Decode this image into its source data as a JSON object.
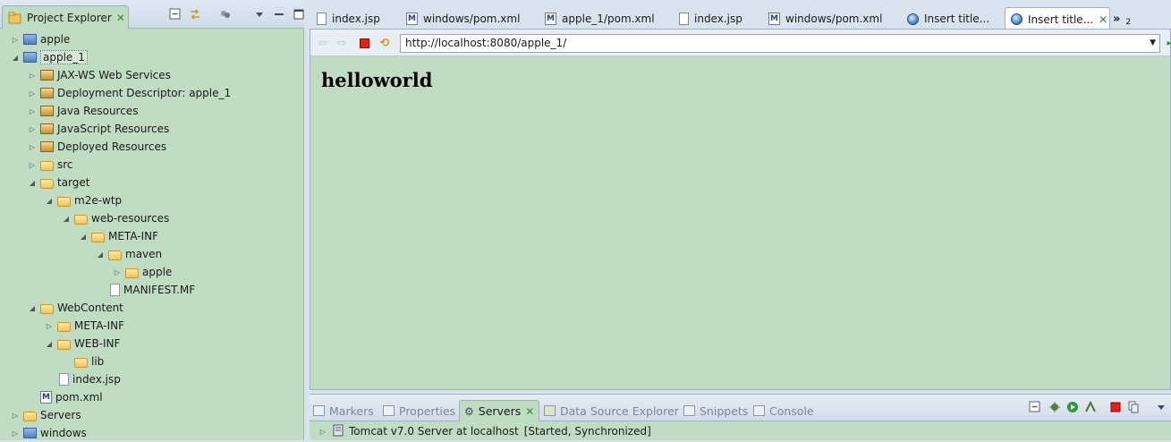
{
  "explorer": {
    "title": "Project Explorer",
    "tree": [
      {
        "label": "apple",
        "depth": 0,
        "twisty": "closed",
        "icon": "project-icon"
      },
      {
        "label": "apple_1",
        "depth": 0,
        "twisty": "open",
        "icon": "project-icon",
        "selected": true
      },
      {
        "label": "JAX-WS Web Services",
        "depth": 1,
        "twisty": "closed",
        "icon": "webservices-icon"
      },
      {
        "label": "Deployment Descriptor: apple_1",
        "depth": 1,
        "twisty": "closed",
        "icon": "descriptor-icon"
      },
      {
        "label": "Java Resources",
        "depth": 1,
        "twisty": "closed",
        "icon": "java-resources-icon"
      },
      {
        "label": "JavaScript Resources",
        "depth": 1,
        "twisty": "closed",
        "icon": "javascript-resources-icon"
      },
      {
        "label": "Deployed Resources",
        "depth": 1,
        "twisty": "closed",
        "icon": "deployed-resources-icon"
      },
      {
        "label": "src",
        "depth": 1,
        "twisty": "closed",
        "icon": "folder-icon"
      },
      {
        "label": "target",
        "depth": 1,
        "twisty": "open",
        "icon": "folder-icon"
      },
      {
        "label": "m2e-wtp",
        "depth": 2,
        "twisty": "open",
        "icon": "folder-icon"
      },
      {
        "label": "web-resources",
        "depth": 3,
        "twisty": "open",
        "icon": "folder-icon"
      },
      {
        "label": "META-INF",
        "depth": 4,
        "twisty": "open",
        "icon": "folder-icon"
      },
      {
        "label": "maven",
        "depth": 5,
        "twisty": "open",
        "icon": "folder-icon"
      },
      {
        "label": "apple",
        "depth": 6,
        "twisty": "closed",
        "icon": "folder-icon"
      },
      {
        "label": "MANIFEST.MF",
        "depth": 5,
        "twisty": "none",
        "icon": "file-icon"
      },
      {
        "label": "WebContent",
        "depth": 1,
        "twisty": "open",
        "icon": "folder-icon"
      },
      {
        "label": "META-INF",
        "depth": 2,
        "twisty": "closed",
        "icon": "folder-icon"
      },
      {
        "label": "WEB-INF",
        "depth": 2,
        "twisty": "open",
        "icon": "folder-icon"
      },
      {
        "label": "lib",
        "depth": 3,
        "twisty": "none",
        "icon": "folder-icon"
      },
      {
        "label": "index.jsp",
        "depth": 2,
        "twisty": "none",
        "icon": "file-icon"
      },
      {
        "label": "pom.xml",
        "depth": 1,
        "twisty": "none",
        "icon": "maven-file-icon"
      },
      {
        "label": "Servers",
        "depth": 0,
        "twisty": "closed",
        "icon": "folder-icon"
      },
      {
        "label": "windows",
        "depth": 0,
        "twisty": "closed",
        "icon": "project-icon"
      }
    ]
  },
  "editor": {
    "tabs": [
      {
        "label": "index.jsp",
        "icon": "jsp-file-icon"
      },
      {
        "label": "windows/pom.xml",
        "icon": "maven-file-icon"
      },
      {
        "label": "apple_1/pom.xml",
        "icon": "maven-file-icon"
      },
      {
        "label": "index.jsp",
        "icon": "jsp-file-icon"
      },
      {
        "label": "windows/pom.xml",
        "icon": "maven-file-icon"
      },
      {
        "label": "Insert title...",
        "icon": "globe-icon"
      },
      {
        "label": "Insert title...",
        "icon": "globe-icon",
        "active": true
      }
    ],
    "overflow_label": "»",
    "overflow_count": "2"
  },
  "browser": {
    "url": "http://localhost:8080/apple_1/",
    "heading": "helloworld"
  },
  "bottom_panel": {
    "tabs": [
      {
        "label": "Markers",
        "icon": "markers-icon"
      },
      {
        "label": "Properties",
        "icon": "properties-icon"
      },
      {
        "label": "Servers",
        "icon": "servers-icon",
        "active": true
      },
      {
        "label": "Data Source Explorer",
        "icon": "datasource-icon"
      },
      {
        "label": "Snippets",
        "icon": "snippets-icon"
      },
      {
        "label": "Console",
        "icon": "console-icon"
      }
    ],
    "server_row": {
      "label": "Tomcat v7.0 Server at localhost",
      "status": "[Started, Synchronized]"
    }
  },
  "colors": {
    "panel_green": "#c0dcc2",
    "chrome_blue": "#d8e3ee",
    "border": "#9fb0c4"
  }
}
